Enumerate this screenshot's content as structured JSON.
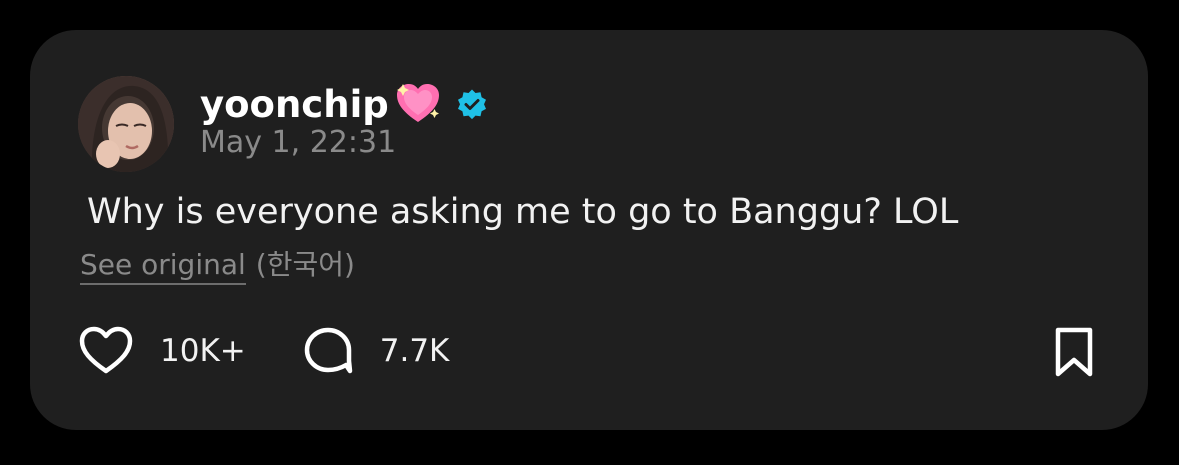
{
  "post": {
    "username": "yoonchip",
    "name_emoji": "pink-sparkling-heart-emoji",
    "verified_icon": "verified-badge-icon",
    "timestamp": "May 1, 22:31",
    "text": "Why is everyone asking me to go to Banggu? LOL",
    "see_original_label": "See original",
    "original_language": "(한국어)"
  },
  "actions": {
    "likes_count": "10K+",
    "comments_count": "7.7K",
    "like_icon": "heart-icon",
    "comment_icon": "comment-bubble-icon",
    "bookmark_icon": "bookmark-icon"
  },
  "colors": {
    "background": "#000000",
    "card": "#1f1f1f",
    "primary_text": "#ffffff",
    "secondary_text": "#8a8a8a",
    "verified_badge": "#1fc0e6",
    "heart_emoji": "#ff6fb1"
  }
}
